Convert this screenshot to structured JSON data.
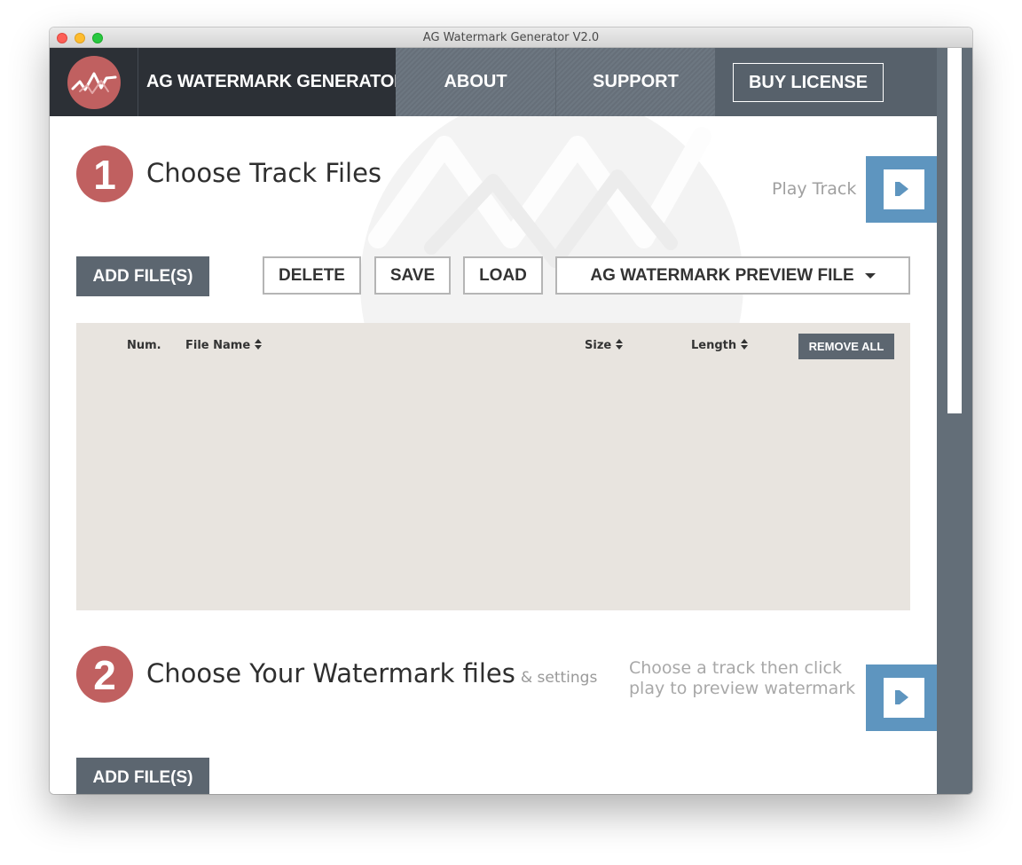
{
  "window": {
    "title": "AG Watermark Generator V2.0"
  },
  "header": {
    "brand": "AG WATERMARK GENERATOR",
    "nav": {
      "about": "ABOUT",
      "support": "SUPPORT"
    },
    "buy_license": "BUY LICENSE"
  },
  "step1": {
    "number": "1",
    "title": "Choose Track Files",
    "play_label": "Play Track",
    "add_files": "ADD FILE(S)",
    "delete": "DELETE",
    "save": "SAVE",
    "load": "LOAD",
    "preview_select": "AG WATERMARK PREVIEW FILE",
    "table": {
      "columns": {
        "num": "Num.",
        "file_name": "File Name",
        "size": "Size",
        "length": "Length"
      },
      "remove_all": "REMOVE ALL",
      "rows": []
    }
  },
  "step2": {
    "number": "2",
    "title": "Choose Your Watermark files",
    "subtitle": "& settings",
    "hint": "Choose a track then click play to preview watermark",
    "add_files": "ADD FILE(S)"
  },
  "colors": {
    "accent_red": "#c06060",
    "header_dark": "#2c3036",
    "nav_gray": "#6d7781",
    "play_blue": "#5e95bf",
    "button_dark": "#5c6670",
    "table_bg": "#e8e4df"
  }
}
